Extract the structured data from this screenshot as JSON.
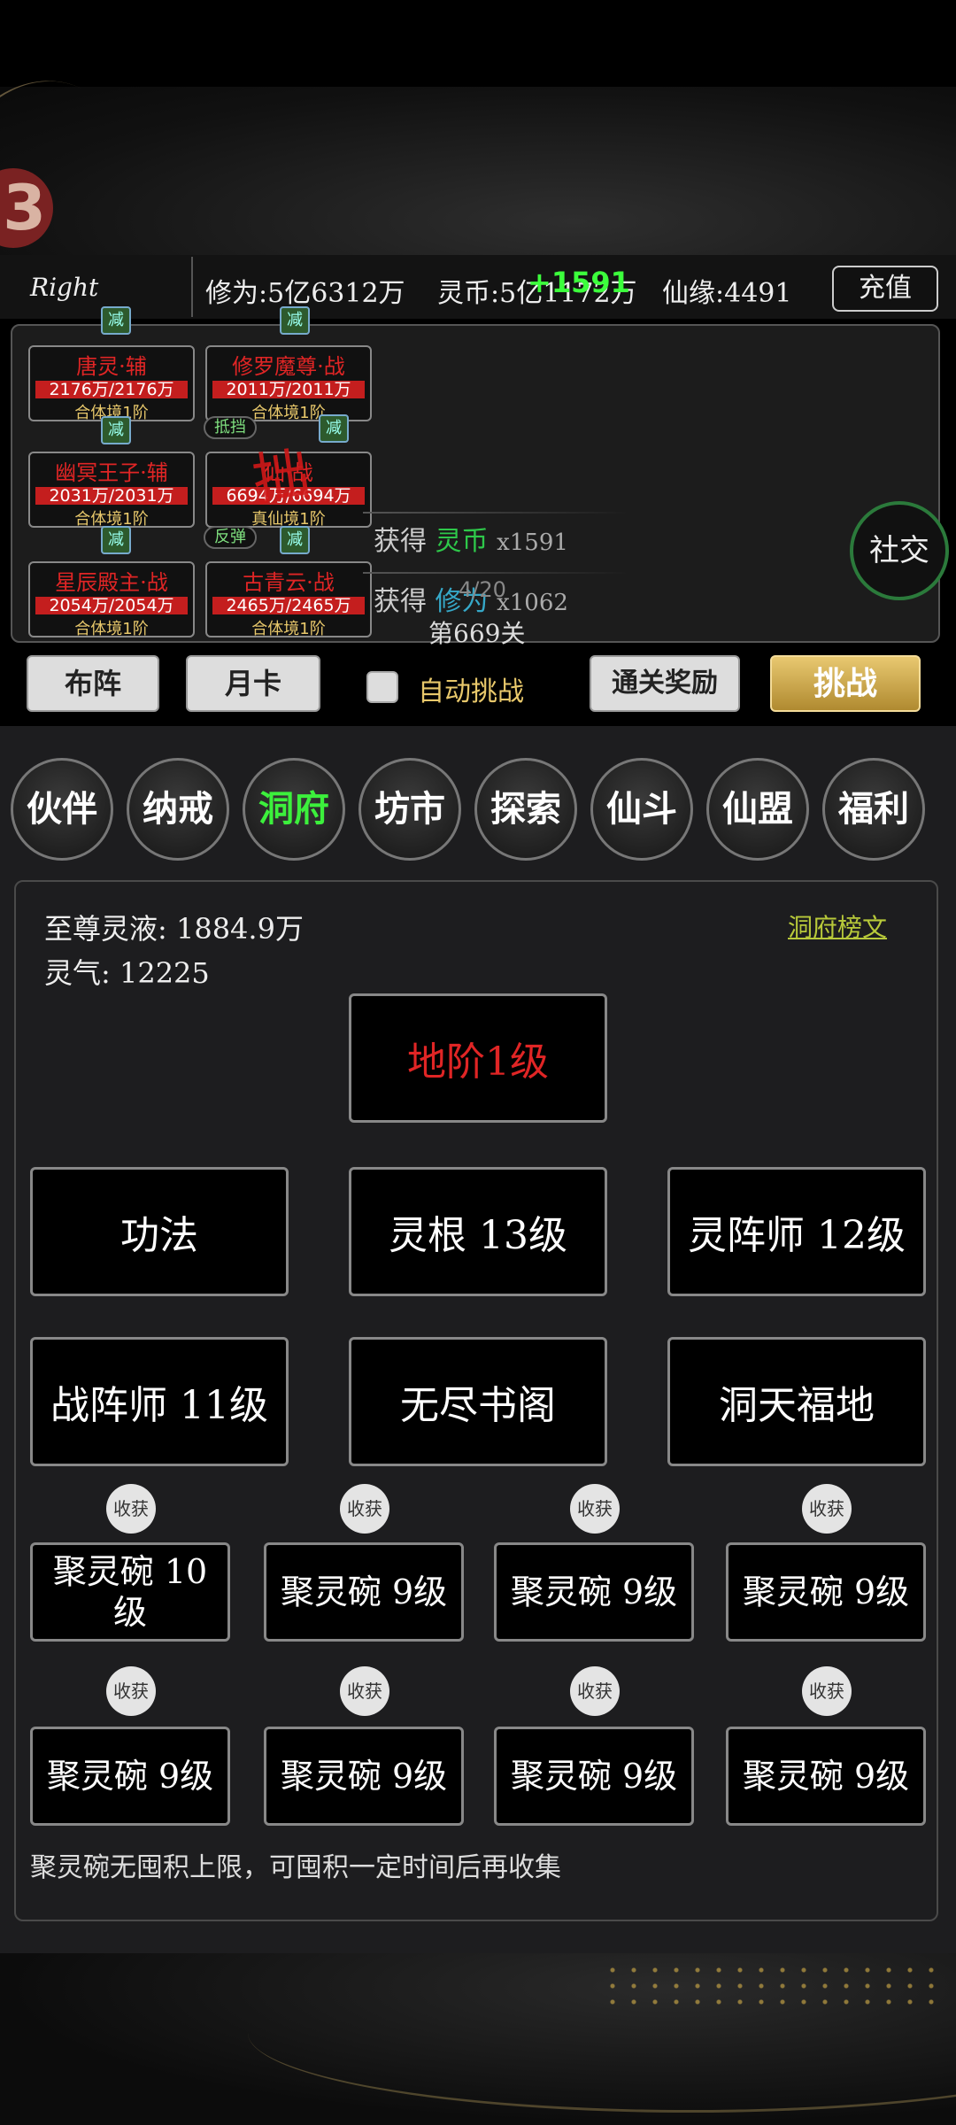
{
  "header": {
    "player_name": "Right",
    "cultivation_label": "修为:",
    "cultivation_value": "5亿6312万",
    "spirit_coin_label": "灵币:",
    "spirit_coin_value": "5亿1172万",
    "fate_label": "仙缘:",
    "fate_value": "4491",
    "float_gain": "+1591",
    "recharge_label": "充值"
  },
  "battle": {
    "cards": [
      {
        "name": "唐灵·辅",
        "hp": "2176万/2176万",
        "realm": "合体境1阶"
      },
      {
        "name": "修罗魔尊·战",
        "hp": "2011万/2011万",
        "realm": "合体境1阶"
      },
      {
        "name": "幽冥王子·辅",
        "hp": "2031万/2031万",
        "realm": "合体境1阶"
      },
      {
        "name": "仙·战",
        "hp": "6694万/6694万",
        "realm": "真仙境1阶"
      },
      {
        "name": "星辰殿主·战",
        "hp": "2054万/2054万",
        "realm": "合体境1阶"
      },
      {
        "name": "古青云·战",
        "hp": "2465万/2465万",
        "realm": "合体境1阶"
      }
    ],
    "buff_label": "减",
    "tag_block": "抵挡",
    "tag_reflect": "反弹",
    "big_word": "拙",
    "log": [
      {
        "prefix": "获得",
        "item": "灵币",
        "amount": "x1591"
      },
      {
        "prefix": "获得",
        "item": "修为",
        "amount": "x1062"
      }
    ],
    "log_overlay": "4/20",
    "stage": "第669关",
    "social_label": "社交"
  },
  "actions": {
    "formation": "布阵",
    "month_card": "月卡",
    "auto_challenge": "自动挑战",
    "clear_reward": "通关奖励",
    "challenge": "挑战"
  },
  "nav": {
    "tabs": [
      "伙伴",
      "纳戒",
      "洞府",
      "坊市",
      "探索",
      "仙斗",
      "仙盟",
      "福利"
    ],
    "active_index": 2
  },
  "cave": {
    "supreme_liquid_label": "至尊灵液:",
    "supreme_liquid_value": "1884.9万",
    "spirit_qi_label": "灵气:",
    "spirit_qi_value": "12225",
    "rank_desc_link": "洞府榜文",
    "ground_level": "地阶1级",
    "buildings": [
      "功法",
      "灵根 13级",
      "灵阵师 12级",
      "战阵师 11级",
      "无尽书阁",
      "洞天福地"
    ],
    "harvest_label": "收获",
    "bowls": [
      "聚灵碗 10级",
      "聚灵碗 9级",
      "聚灵碗 9级",
      "聚灵碗 9级",
      "聚灵碗 9级",
      "聚灵碗 9级",
      "聚灵碗 9级",
      "聚灵碗 9级"
    ],
    "note": "聚灵碗无囤积上限，可囤积一定时间后再收集"
  },
  "colors": {
    "accent_gold": "#e8c86b",
    "active_green": "#3cf03c",
    "hp_red": "#c41e1e",
    "name_red": "#e02525"
  }
}
